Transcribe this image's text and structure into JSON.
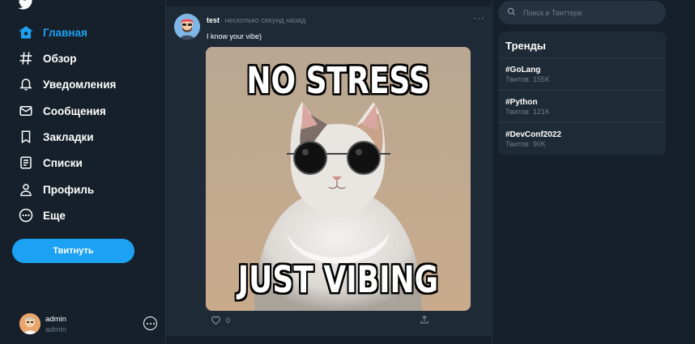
{
  "sidebar": {
    "logo": "twitter-bird-icon",
    "items": [
      {
        "label": "Главная",
        "icon": "home-icon",
        "active": true
      },
      {
        "label": "Обзор",
        "icon": "hashtag-icon"
      },
      {
        "label": "Уведомления",
        "icon": "bell-icon"
      },
      {
        "label": "Сообщения",
        "icon": "mail-icon"
      },
      {
        "label": "Закладки",
        "icon": "bookmark-icon"
      },
      {
        "label": "Списки",
        "icon": "list-icon"
      },
      {
        "label": "Профиль",
        "icon": "person-icon"
      },
      {
        "label": "Еще",
        "icon": "more-circle-icon"
      }
    ],
    "tweet_button": "Твитнуть",
    "account": {
      "name": "admin",
      "handle": "admin"
    }
  },
  "tweet": {
    "author": "test",
    "time": "· несколько секунд назад",
    "menu": "···",
    "text": "I know your vibe)",
    "meme_top": "NO STRESS",
    "meme_bottom": "JUST VIBING",
    "likes": "0"
  },
  "search": {
    "placeholder": "Поиск в Твиттере"
  },
  "trends": {
    "title": "Тренды",
    "items": [
      {
        "tag": "#GoLang",
        "count": "Твитов: 155K"
      },
      {
        "tag": "#Python",
        "count": "Твитов: 121K"
      },
      {
        "tag": "#DevConf2022",
        "count": "Твитов: 90K"
      }
    ]
  },
  "colors": {
    "accent": "#1da1f2",
    "background": "#15202b",
    "card": "#1e2a36",
    "muted": "#6e7d8c"
  }
}
